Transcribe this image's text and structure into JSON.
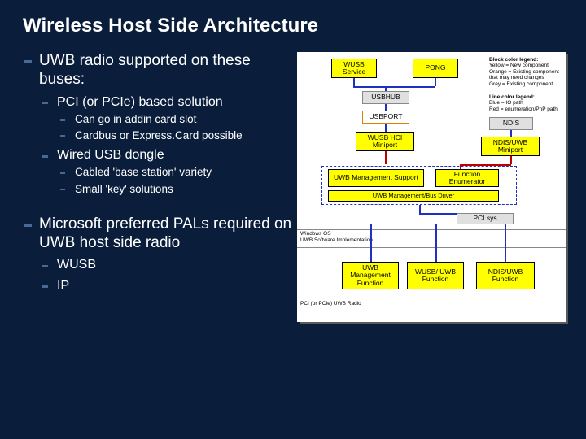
{
  "title": "Wireless Host Side Architecture",
  "bullets": {
    "b1": "UWB radio supported on these buses:",
    "b1a": "PCI (or PCIe) based solution",
    "b1a1": "Can go in addin card slot",
    "b1a2": "Cardbus or Express.Card possible",
    "b1b": "Wired USB dongle",
    "b1b1": "Cabled 'base station' variety",
    "b1b2": "Small 'key' solutions",
    "b2": "Microsoft preferred PALs required on UWB host side radio",
    "b2a": "WUSB",
    "b2b": "IP"
  },
  "diagram": {
    "wusb_service": "WUSB Service",
    "pong": "PONG",
    "usbhub": "USBHUB",
    "usbport": "USBPORT",
    "ndis": "NDIS",
    "wusb_hci": "WUSB HCI Miniport",
    "ndis_uwb": "NDIS/UWB Miniport",
    "uwb_mgmt": "UWB Management Support",
    "func_enum": "Function Enumerator",
    "uwb_bus": "UWB Management/Bus Driver",
    "pci_sys": "PCI.sys",
    "uwb_mgmt_fn": "UWB Management Function",
    "wusb_uwb_fn": "WUSB/ UWB Function",
    "ndis_uwb_fn": "NDIS/UWB Function",
    "legend_block_title": "Block color legend:",
    "legend_block_1": "Yellow = New component",
    "legend_block_2": "Orange = Existing component that may need changes",
    "legend_block_3": "Grey = Existing component",
    "legend_line_title": "Line color legend:",
    "legend_line_1": "Blue = IO path",
    "legend_line_2": "Red = enumeration/PnP path",
    "side_os": "Windows OS",
    "side_sw": "UWB Software Implementation",
    "side_radio": "PCI (or PCIe) UWB Radio"
  }
}
